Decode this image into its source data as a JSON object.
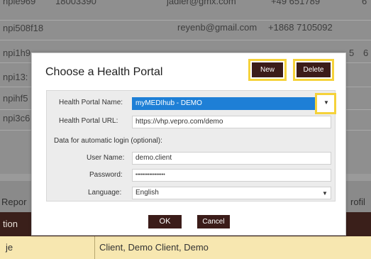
{
  "background": {
    "rows": [
      {
        "c1": "npie969",
        "c2": "18003390",
        "c3": "jadler@gmx.com",
        "c4": "+49 651789",
        "c5": "6"
      },
      {
        "c1": "npi508f18",
        "c2": "",
        "c3": "reyenb@gmail.com",
        "c4": "+1868 7105092",
        "c5": ""
      },
      {
        "c1": "npi1h9",
        "c2": "",
        "c3": "",
        "c4": "5",
        "c5": "6"
      },
      {
        "c1": "npi13:",
        "c2": "",
        "c3": "",
        "c4": "",
        "c5": ""
      },
      {
        "c1": "npihf5",
        "c2": "",
        "c3": "",
        "c4": "",
        "c5": ""
      },
      {
        "c1": "npi3c6",
        "c2": "",
        "c3": "",
        "c4": "",
        "c5": ""
      }
    ],
    "report_left": "Repor",
    "report_right": "rofil",
    "header_text": "tion",
    "data_row": {
      "col1": "je",
      "col2": "Client, Demo  Client, Demo"
    }
  },
  "dialog": {
    "title": "Choose a Health Portal",
    "new_label": "New",
    "delete_label": "Delete",
    "portal_name_label": "Health Portal Name:",
    "portal_name_value": "myMEDIhub - DEMO",
    "portal_url_label": "Health Portal URL:",
    "portal_url_value": "https://vhp.vepro.com/demo",
    "auto_login_label": "Data for automatic login (optional):",
    "user_name_label": "User Name:",
    "user_name_value": "demo.client",
    "password_label": "Password:",
    "password_value": "•••••••••••••••••",
    "language_label": "Language:",
    "language_value": "English",
    "ok_label": "OK",
    "cancel_label": "Cancel",
    "dropdown_arrow": "▼"
  },
  "colors": {
    "highlight": "#f5d23a",
    "button_dark": "#3b1c19",
    "selection": "#1e7fd6"
  }
}
